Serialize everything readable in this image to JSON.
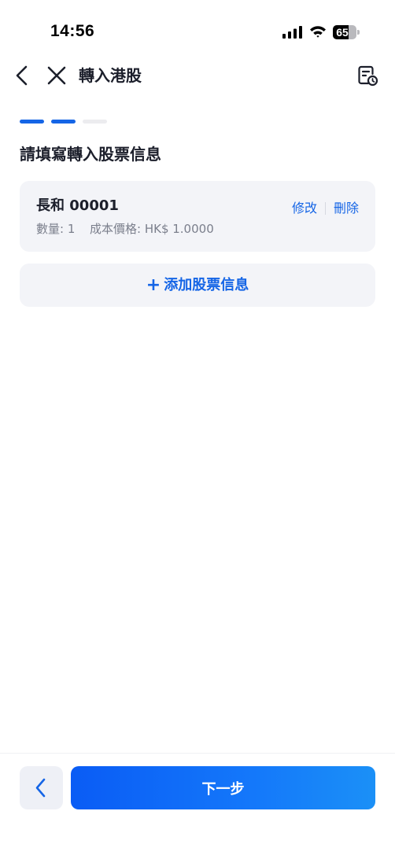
{
  "status_bar": {
    "time": "14:56",
    "battery_percent": 65,
    "battery_label": "65"
  },
  "nav": {
    "title": "轉入港股",
    "icons": [
      "back-chevron-icon",
      "close-icon",
      "history-document-clock-icon"
    ]
  },
  "steps": {
    "total": 3,
    "completed": 2,
    "active_color": "#1565e6",
    "inactive_color": "#ececef"
  },
  "section": {
    "title": "請填寫轉入股票信息"
  },
  "stock_card": {
    "name": "長和 00001",
    "quantity": "數量: 1",
    "cost": "成本價格: HK$ 1.0000",
    "edit_label": "修改",
    "delete_label": "刪除"
  },
  "add_stock": {
    "plus": "+",
    "label": "添加股票信息"
  },
  "bottom": {
    "next_label": "下一步"
  },
  "colors": {
    "accent": "#1565e6",
    "card_bg": "#f3f4f8",
    "text_primary": "#1c1f2b",
    "text_secondary": "#7b7f8c"
  }
}
